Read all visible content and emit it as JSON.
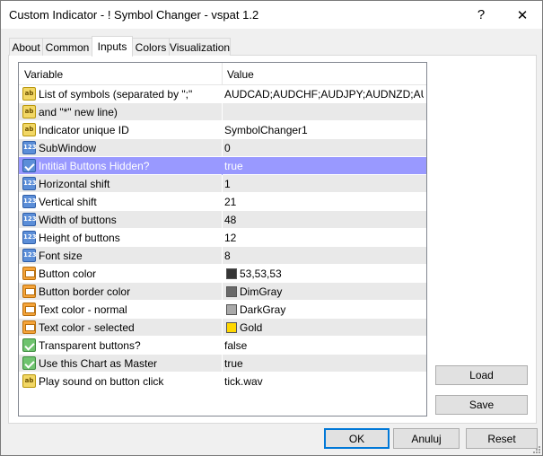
{
  "window": {
    "title": "Custom Indicator - ! Symbol Changer - vspat 1.2",
    "help_glyph": "?",
    "close_glyph": "✕"
  },
  "tabs": [
    "About",
    "Common",
    "Inputs",
    "Colors",
    "Visualization"
  ],
  "active_tab": "Inputs",
  "grid": {
    "headers": {
      "variable": "Variable",
      "value": "Value"
    },
    "rows": [
      {
        "icon": "string-icon",
        "name": "List of symbols (separated by \";\"",
        "value": "AUDCAD;AUDCHF;AUDJPY;AUDNZD;AU..."
      },
      {
        "icon": "string-icon",
        "name": "and \"*\" new line)",
        "value": ""
      },
      {
        "icon": "string-icon",
        "name": "Indicator unique ID",
        "value": "SymbolChanger1"
      },
      {
        "icon": "integer-icon",
        "name": "SubWindow",
        "value": "0"
      },
      {
        "icon": "boolean-icon",
        "name": "Intitial Buttons Hidden?",
        "value": "true",
        "selected": true
      },
      {
        "icon": "integer-icon",
        "name": "Horizontal shift",
        "value": "1"
      },
      {
        "icon": "integer-icon",
        "name": "Vertical shift",
        "value": "21"
      },
      {
        "icon": "integer-icon",
        "name": "Width of buttons",
        "value": "48"
      },
      {
        "icon": "integer-icon",
        "name": "Height of buttons",
        "value": "12"
      },
      {
        "icon": "integer-icon",
        "name": "Font size",
        "value": "8"
      },
      {
        "icon": "color-icon",
        "name": "Button color",
        "value": "53,53,53",
        "swatch": "#353535"
      },
      {
        "icon": "color-icon",
        "name": "Button border color",
        "value": "DimGray",
        "swatch": "#696969"
      },
      {
        "icon": "color-icon",
        "name": "Text color - normal",
        "value": "DarkGray",
        "swatch": "#a9a9a9"
      },
      {
        "icon": "color-icon",
        "name": "Text color - selected",
        "value": "Gold",
        "swatch": "#ffd700"
      },
      {
        "icon": "boolean-green-icon",
        "name": "Transparent buttons?",
        "value": "false"
      },
      {
        "icon": "boolean-green-icon",
        "name": "Use this Chart as Master",
        "value": "true"
      },
      {
        "icon": "string-icon",
        "name": "Play sound on button click",
        "value": "tick.wav"
      }
    ]
  },
  "buttons": {
    "load": "Load",
    "save": "Save",
    "ok": "OK",
    "cancel": "Anuluj",
    "reset": "Reset"
  },
  "colors": {
    "selection": "#9999ff",
    "alt_row": "#e9e9e9",
    "default_button_border": "#0078d7"
  }
}
